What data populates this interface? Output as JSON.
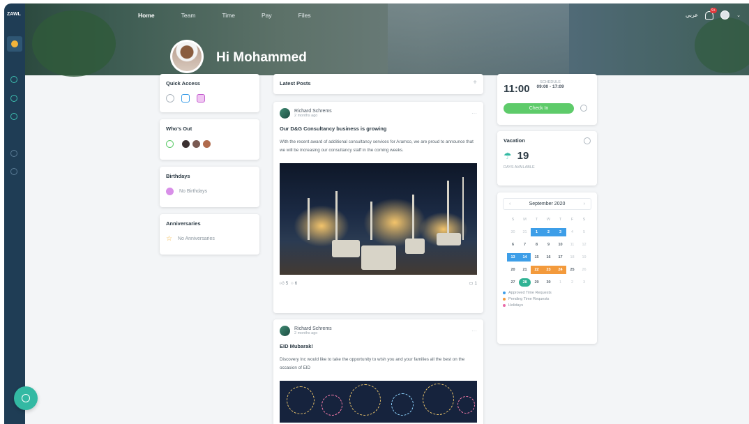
{
  "app": {
    "logo": "ZAWL"
  },
  "nav": {
    "items": [
      "Home",
      "Team",
      "Time",
      "Pay",
      "Files"
    ],
    "active": "Home"
  },
  "header": {
    "language": "عربي",
    "notification_badge": "9+",
    "greeting": "Hi Mohammed"
  },
  "quick_access": {
    "title": "Quick Access"
  },
  "whos_out": {
    "title": "Who's Out"
  },
  "birthdays": {
    "title": "Birthdays",
    "empty": "No Birthdays"
  },
  "anniversaries": {
    "title": "Anniversaries",
    "empty": "No Anniversaries"
  },
  "feed": {
    "title": "Latest Posts",
    "add": "+",
    "posts": [
      {
        "author": "Richard Schrems",
        "time": "2 months ago",
        "title": "Our D&G Consultancy business is growing",
        "body": "With the recent award of additional consultancy services for Aramco, we are proud to announce that we will be increasing our consultancy staff in the coming weeks.",
        "likes": "5",
        "comments": "6",
        "views": "1"
      },
      {
        "author": "Richard Schrems",
        "time": "2 months ago",
        "title": "EID Mubarak!",
        "body": "Discovery Inc would like to take the opportunity to wish you and your families all the best on the occasion of EID"
      }
    ]
  },
  "schedule": {
    "time": "11:00",
    "label": "SCHEDULE",
    "range": "09:00 - 17:09",
    "checkin": "Check In"
  },
  "vacation": {
    "title": "Vacation",
    "days": "19",
    "caption": "DAYS AVAILABLE"
  },
  "calendar": {
    "month": "September 2020",
    "prev": "‹",
    "next": "›",
    "weekdays": [
      "S",
      "M",
      "T",
      "W",
      "T",
      "F",
      "S"
    ],
    "rows": [
      [
        "30",
        "31",
        "1",
        "2",
        "3",
        "4",
        "5"
      ],
      [
        "6",
        "7",
        "8",
        "9",
        "10",
        "11",
        "12"
      ],
      [
        "13",
        "14",
        "15",
        "16",
        "17",
        "18",
        "19"
      ],
      [
        "20",
        "21",
        "22",
        "23",
        "24",
        "25",
        "26"
      ],
      [
        "27",
        "28",
        "29",
        "30",
        "1",
        "2",
        "3"
      ]
    ],
    "legend": [
      "Approved Time Requests",
      "Pending Time Requests",
      "Holidays"
    ],
    "colors": {
      "approved": "#3d9ee8",
      "pending": "#f39a3c",
      "holiday": "#e86aa8",
      "today": "#30b394"
    }
  }
}
